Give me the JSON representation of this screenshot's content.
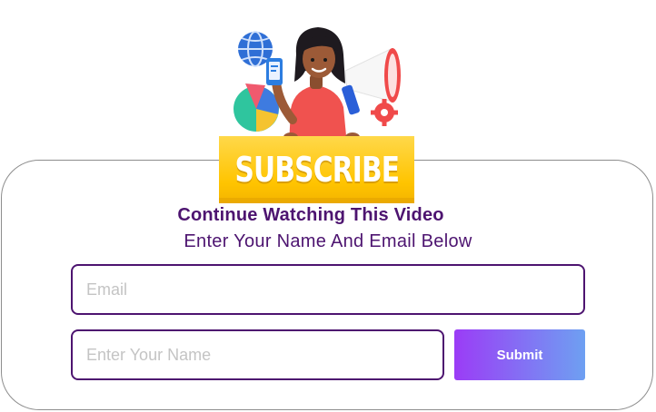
{
  "hero": {
    "sign_text": "SUBSCRIBE",
    "illustration": "woman-holding-phone-with-megaphone-globe-pie-chart-gear",
    "colors": {
      "sign": "#ffc400",
      "shirt": "#f0524f",
      "megaphone": "#ffffff",
      "globe": "#2f6fd6"
    }
  },
  "form": {
    "title": "Continue Watching This Video",
    "subtitle": "Enter Your Name And Email Below",
    "email_placeholder": "Email",
    "name_placeholder": "Enter Your Name",
    "submit_label": "Submit"
  },
  "colors": {
    "text_purple": "#4d1470",
    "button_gradient_start": "#9b3cf6",
    "button_gradient_end": "#6ea0f2",
    "card_border": "#8d8d8d"
  }
}
